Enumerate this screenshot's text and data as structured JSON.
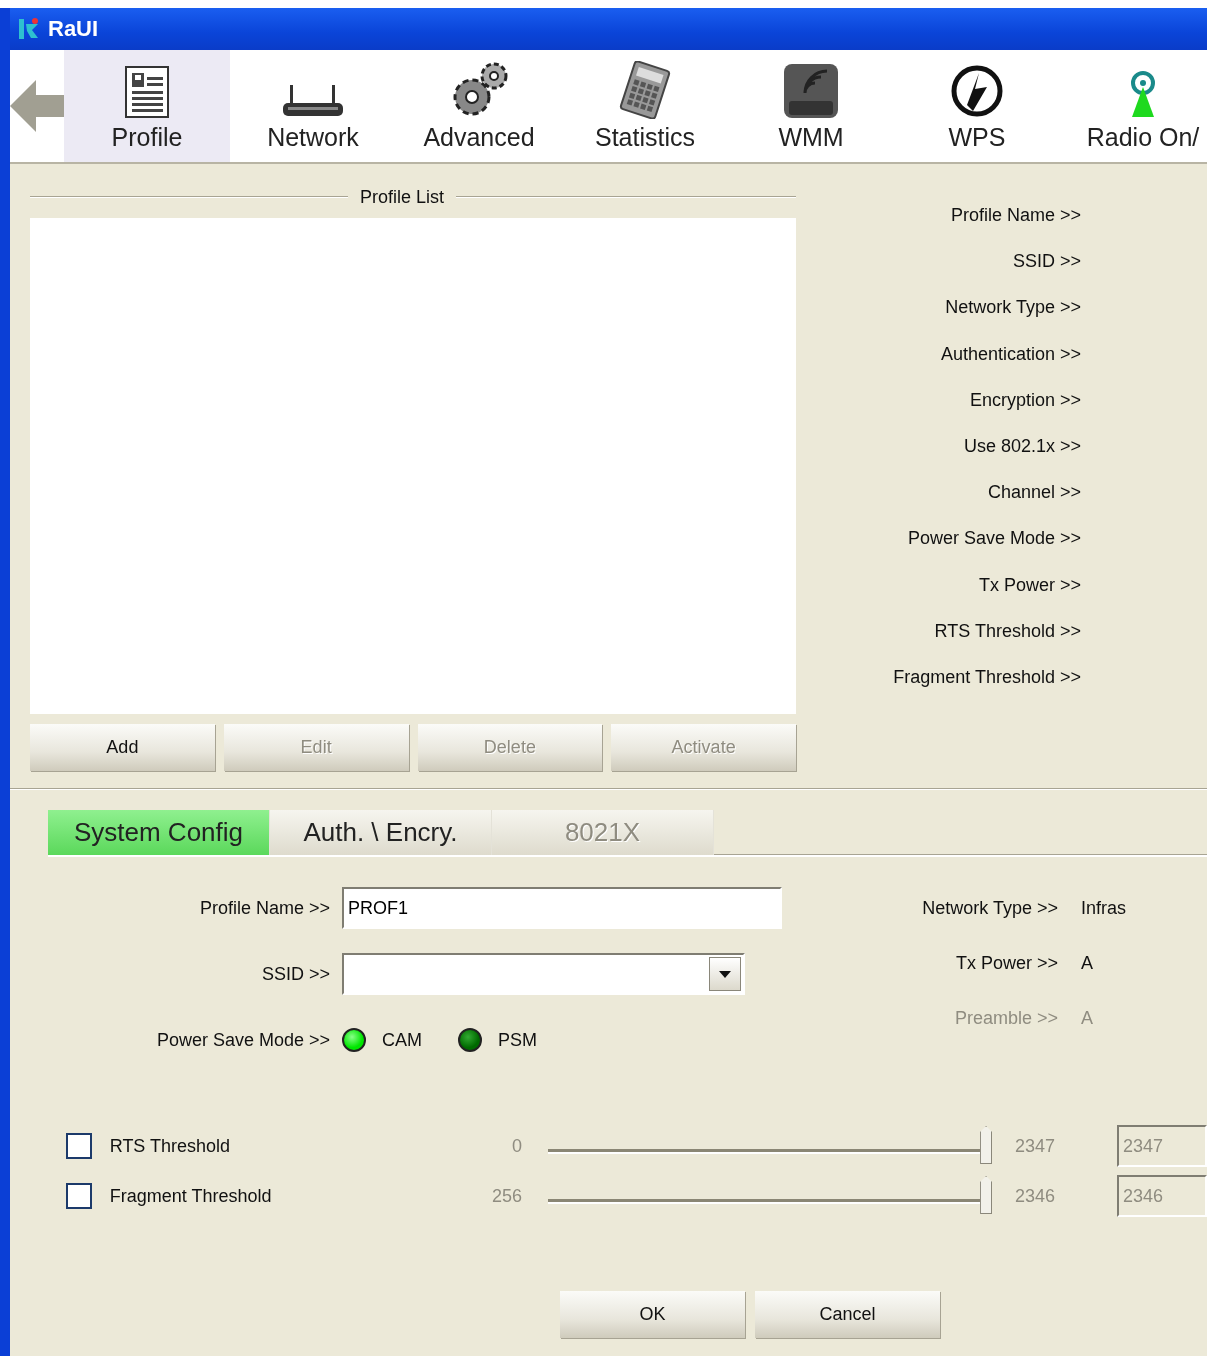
{
  "window": {
    "title": "RaUI"
  },
  "toolbar": [
    {
      "label": "Profile",
      "selected": true,
      "kind": "profile"
    },
    {
      "label": "Network",
      "selected": false,
      "kind": "network"
    },
    {
      "label": "Advanced",
      "selected": false,
      "kind": "advanced"
    },
    {
      "label": "Statistics",
      "selected": false,
      "kind": "statistics"
    },
    {
      "label": "WMM",
      "selected": false,
      "kind": "wmm"
    },
    {
      "label": "WPS",
      "selected": false,
      "kind": "wps"
    },
    {
      "label": "Radio On/",
      "selected": false,
      "kind": "radio"
    }
  ],
  "profile_list": {
    "title": "Profile List",
    "buttons": [
      {
        "label": "Add",
        "disabled": false
      },
      {
        "label": "Edit",
        "disabled": true
      },
      {
        "label": "Delete",
        "disabled": true
      },
      {
        "label": "Activate",
        "disabled": true
      }
    ]
  },
  "profile_details": [
    "Profile Name >>",
    "SSID >>",
    "Network Type >>",
    "Authentication >>",
    "Encryption >>",
    "Use 802.1x >>",
    "Channel >>",
    "Power Save Mode >>",
    "Tx Power >>",
    "RTS Threshold >>",
    "Fragment Threshold >>"
  ],
  "tabs": [
    {
      "label": "System Config",
      "selected": true,
      "disabled": false
    },
    {
      "label": "Auth. \\ Encry.",
      "selected": false,
      "disabled": false
    },
    {
      "label": "8021X",
      "selected": false,
      "disabled": true
    }
  ],
  "system_config": {
    "profile_name": {
      "label": "Profile Name >>",
      "value": "PROF1"
    },
    "ssid": {
      "label": "SSID >>"
    },
    "power_save_mode": {
      "label": "Power Save Mode >>",
      "options": [
        {
          "label": "CAM",
          "selected": true
        },
        {
          "label": "PSM",
          "selected": false
        }
      ]
    },
    "info": [
      {
        "label": "Network Type >>",
        "value": "Infras",
        "disabled": false
      },
      {
        "label": "Tx Power >>",
        "value": "A",
        "disabled": false
      },
      {
        "label": "Preamble >>",
        "value": "A",
        "disabled": true
      }
    ],
    "thresholds": [
      {
        "label": "RTS Threshold",
        "checked": false,
        "min": "0",
        "max": "2347",
        "level": 1,
        "value": "2347"
      },
      {
        "label": "Fragment Threshold",
        "checked": false,
        "min": "256",
        "max": "2346",
        "level": 1,
        "value": "2346"
      }
    ]
  },
  "buttons": [
    {
      "label": "OK"
    },
    {
      "label": "Cancel"
    }
  ]
}
